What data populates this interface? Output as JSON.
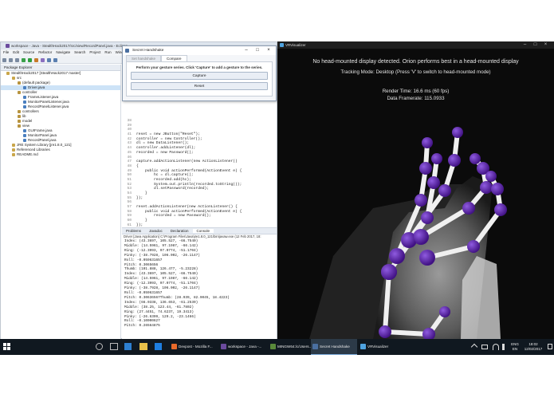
{
  "eclipse": {
    "title": "workspace - Java - StealthHack2017/src/view/RecordPanel.java - Eclipse",
    "menu": [
      "File",
      "Edit",
      "Source",
      "Refactor",
      "Navigate",
      "Search",
      "Project",
      "Run",
      "Window"
    ],
    "package_explorer": {
      "header": "Package Explorer",
      "items": [
        {
          "label": "StealthHack2017 [StealthHack2017 master]",
          "indent": 1
        },
        {
          "label": "src",
          "indent": 2
        },
        {
          "label": "(default package)",
          "indent": 3
        },
        {
          "label": "Driver.java",
          "indent": 4,
          "selected": true
        },
        {
          "label": "controller",
          "indent": 3
        },
        {
          "label": "FrameListener.java",
          "indent": 4
        },
        {
          "label": "MonitorPanelListener.java",
          "indent": 4
        },
        {
          "label": "RecordPanelListener.java",
          "indent": 4
        },
        {
          "label": "controllers",
          "indent": 3
        },
        {
          "label": "lib",
          "indent": 3
        },
        {
          "label": "model",
          "indent": 3
        },
        {
          "label": "view",
          "indent": 3
        },
        {
          "label": "GUIFrame.java",
          "indent": 4
        },
        {
          "label": "MonitorPanel.java",
          "indent": 4
        },
        {
          "label": "RecordPanel.java",
          "indent": 4
        },
        {
          "label": "JRE System Library [jre1.8.0_121]",
          "indent": 2
        },
        {
          "label": "Referenced Libraries",
          "indent": 2
        },
        {
          "label": "README.md",
          "indent": 2
        }
      ]
    },
    "editor": {
      "line_numbers": [
        "35",
        "36",
        "37",
        "38",
        "39",
        "40",
        "41",
        "42",
        "43",
        "44",
        "45",
        "46",
        "47",
        "48",
        "49",
        "50",
        "51",
        "52",
        "53",
        "54",
        "55",
        "56",
        "57",
        "58",
        "59",
        "60",
        "61",
        "62",
        "63",
        "64",
        "65",
        "66",
        "67",
        "68",
        "69",
        "70",
        "71"
      ],
      "lines": [
        "",
        "",
        "",
        "reset = new JButton(\"Reset\");",
        "controller = new Controller();",
        "dl = new DataListener();",
        "controller.addListener(dl);",
        "recorded = new Password();",
        "",
        "capture.addActionListener(new ActionListener()",
        "{",
        "    public void actionPerformed(ActionEvent e) {",
        "        hc = dl.capture();",
        "        recorded.add(hc);",
        "        System.out.println(recorded.toString());",
        "        dl.setPassword(recorded);",
        "    }",
        "});",
        "",
        "reset.addActionListener(new ActionListener() {",
        "    public void actionPerformed(ActionEvent e) {",
        "        recorded = new Password();",
        "    }",
        "});",
        "",
        "",
        "",
        "this.setLayout(new GridBagLayout());",
        "GridBagConstraints c = new GridBagConstraints();",
        "",
        "c.fill = GridBagConstraints.BOTH;"
      ]
    },
    "console": {
      "tabs": [
        "Problems",
        "Javadoc",
        "Declaration",
        "Console"
      ],
      "active_tab": "Console",
      "header": "Driver [Java Application] C:\\Program Files\\Java\\jre1.8.0_121\\bin\\javaw.exe (12 Feb 2017, 18:",
      "lines": [
        "Index: (43.3697, 105.527, -66.7540)",
        "Middle: (14.5961, 97.1987, -66.142)",
        "Ring: (-12.3993, 97.0774, -51.1704)",
        "Pinky: (-38.7928, 106.002, -26.1147)",
        "Roll: -0.059631657",
        "Pitch: 0.3065656",
        "Thumb: (101.888, 126.477, -5.23228)",
        "Index: (43.3697, 105.527, -66.7540)",
        "Middle: (14.5961, 97.1987, -66.142)",
        "Ring: (-12.3993, 97.0774, -51.1704)",
        "Pinky: (-38.7928, 106.002, -26.1147)",
        "Roll: -0.059631657",
        "Pitch: 0.30636567Thumb: (28.939, 82.9045, 18.4223)",
        "Index: (66.0338, 136.653, -61.2539)",
        "Middle: (38.25, 123.44, -61.7802)",
        "Ring: (27.4451, 74.6237, 19.3413)",
        "Pinky: (-26.6399, 129.2, -23.1466)",
        "Roll: -0.10000627",
        "Pitch: 0.26564875"
      ]
    }
  },
  "dialog": {
    "title": "Secret Handshake",
    "tabs": [
      "Set handshake",
      "Compare"
    ],
    "active_tab": "Compare",
    "instruction": "Perform your gesture series. Click 'Capture' to add a gesture to the series.",
    "capture_label": "Capture",
    "reset_label": "Reset"
  },
  "visualizer": {
    "title": "VRVisualizer",
    "line1": "No head-mounted display detected. Orion performs best in a head-mounted display",
    "line2": "Tracking Mode: Desktop (Press 'V' to switch to head-mounted mode)",
    "line3": "Render Time: 16.6 ms (60 fps)",
    "line4": "Data Framerate: 115.0933"
  },
  "taskbar": {
    "tasks": [
      "Devpost - Mozilla F...",
      "workspace - Java -...",
      "MINGW64:/c/Users...",
      "Secret Handshake",
      "VRVisualizer"
    ],
    "language": "ENG",
    "region": "EN",
    "time": "18:02",
    "date": "12/02/2017"
  },
  "colors": {
    "joint_purple": "#5b1fa8",
    "bone_white": "#f2f2f2",
    "taskbar_bg": "#101820"
  }
}
